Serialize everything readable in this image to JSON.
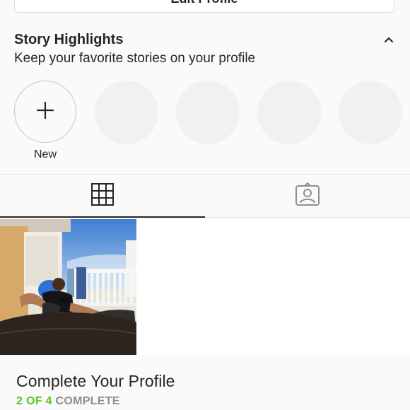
{
  "profile": {
    "edit_button_label": "Edit Profile"
  },
  "highlights": {
    "title": "Story Highlights",
    "subtitle": "Keep your favorite stories on your profile",
    "new_label": "New",
    "toggle_icon": "chevron-up-icon"
  },
  "tabs": [
    {
      "icon": "grid-icon",
      "active": true
    },
    {
      "icon": "tagged-icon",
      "active": false
    }
  ],
  "complete_profile": {
    "title": "Complete Your Profile",
    "progress_done": "2 OF 4",
    "progress_rest": " COMPLETE"
  },
  "colors": {
    "progress_green": "#58c322",
    "placeholder_gray": "#f1f1f1",
    "text": "#262626"
  }
}
